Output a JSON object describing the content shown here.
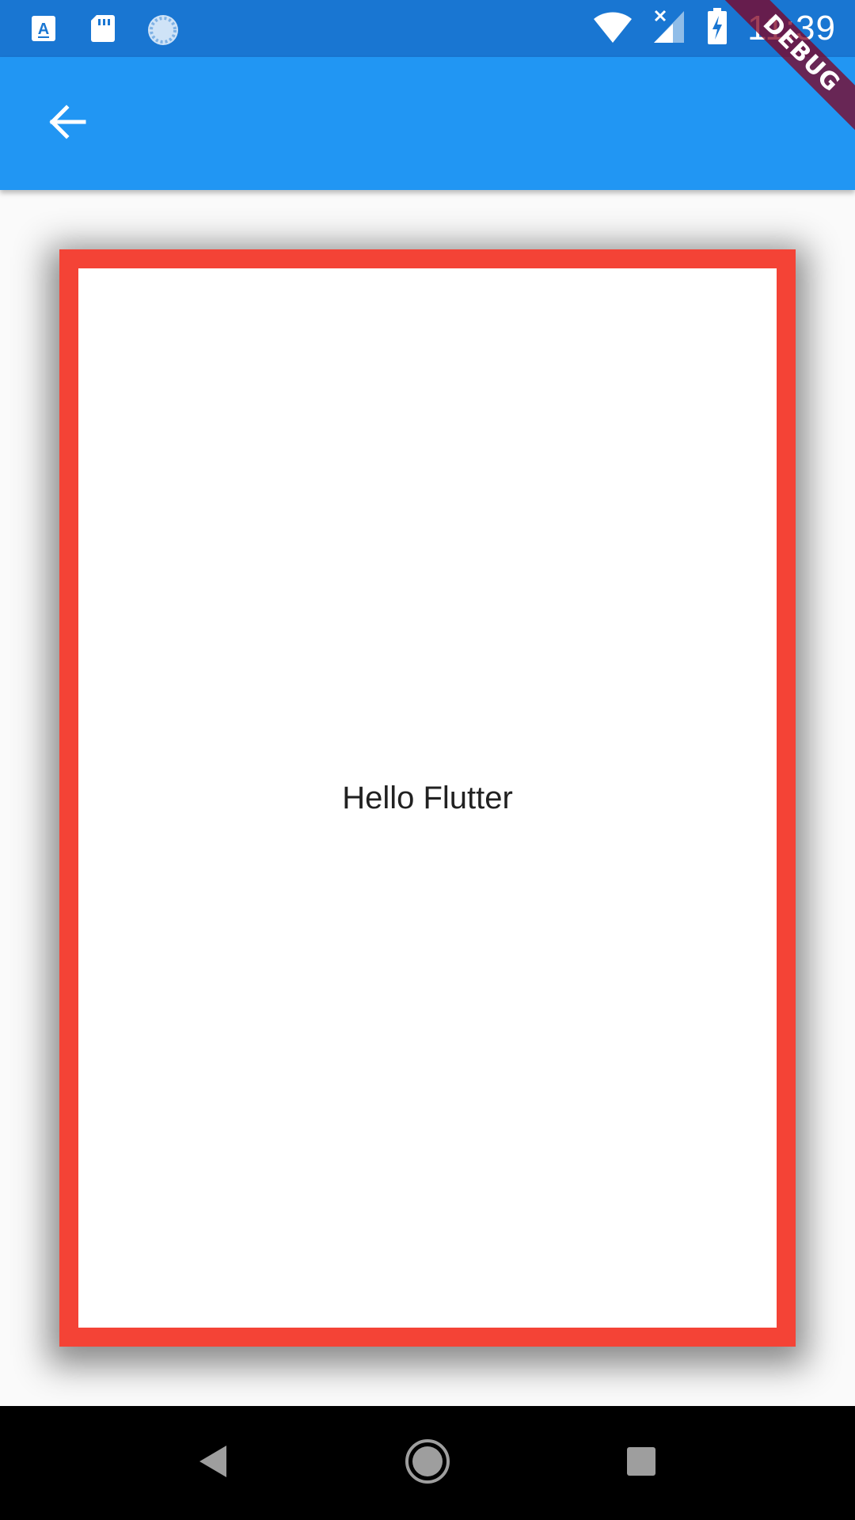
{
  "status_bar": {
    "time": "11:39",
    "icons": [
      "a-notification-icon",
      "sd-card-icon",
      "sync-icon",
      "wifi-icon",
      "cellular-no-signal-icon",
      "battery-charging-icon"
    ],
    "background": "#1976d2"
  },
  "app_bar": {
    "back_icon": "arrow-back-icon",
    "background": "#2196f3"
  },
  "debug_banner": {
    "label": "DEBUG"
  },
  "card": {
    "text": "Hello Flutter",
    "border_color": "#f44336",
    "background": "#ffffff"
  },
  "nav_bar": {
    "icons": [
      "nav-back-icon",
      "nav-home-icon",
      "nav-recent-icon"
    ]
  }
}
